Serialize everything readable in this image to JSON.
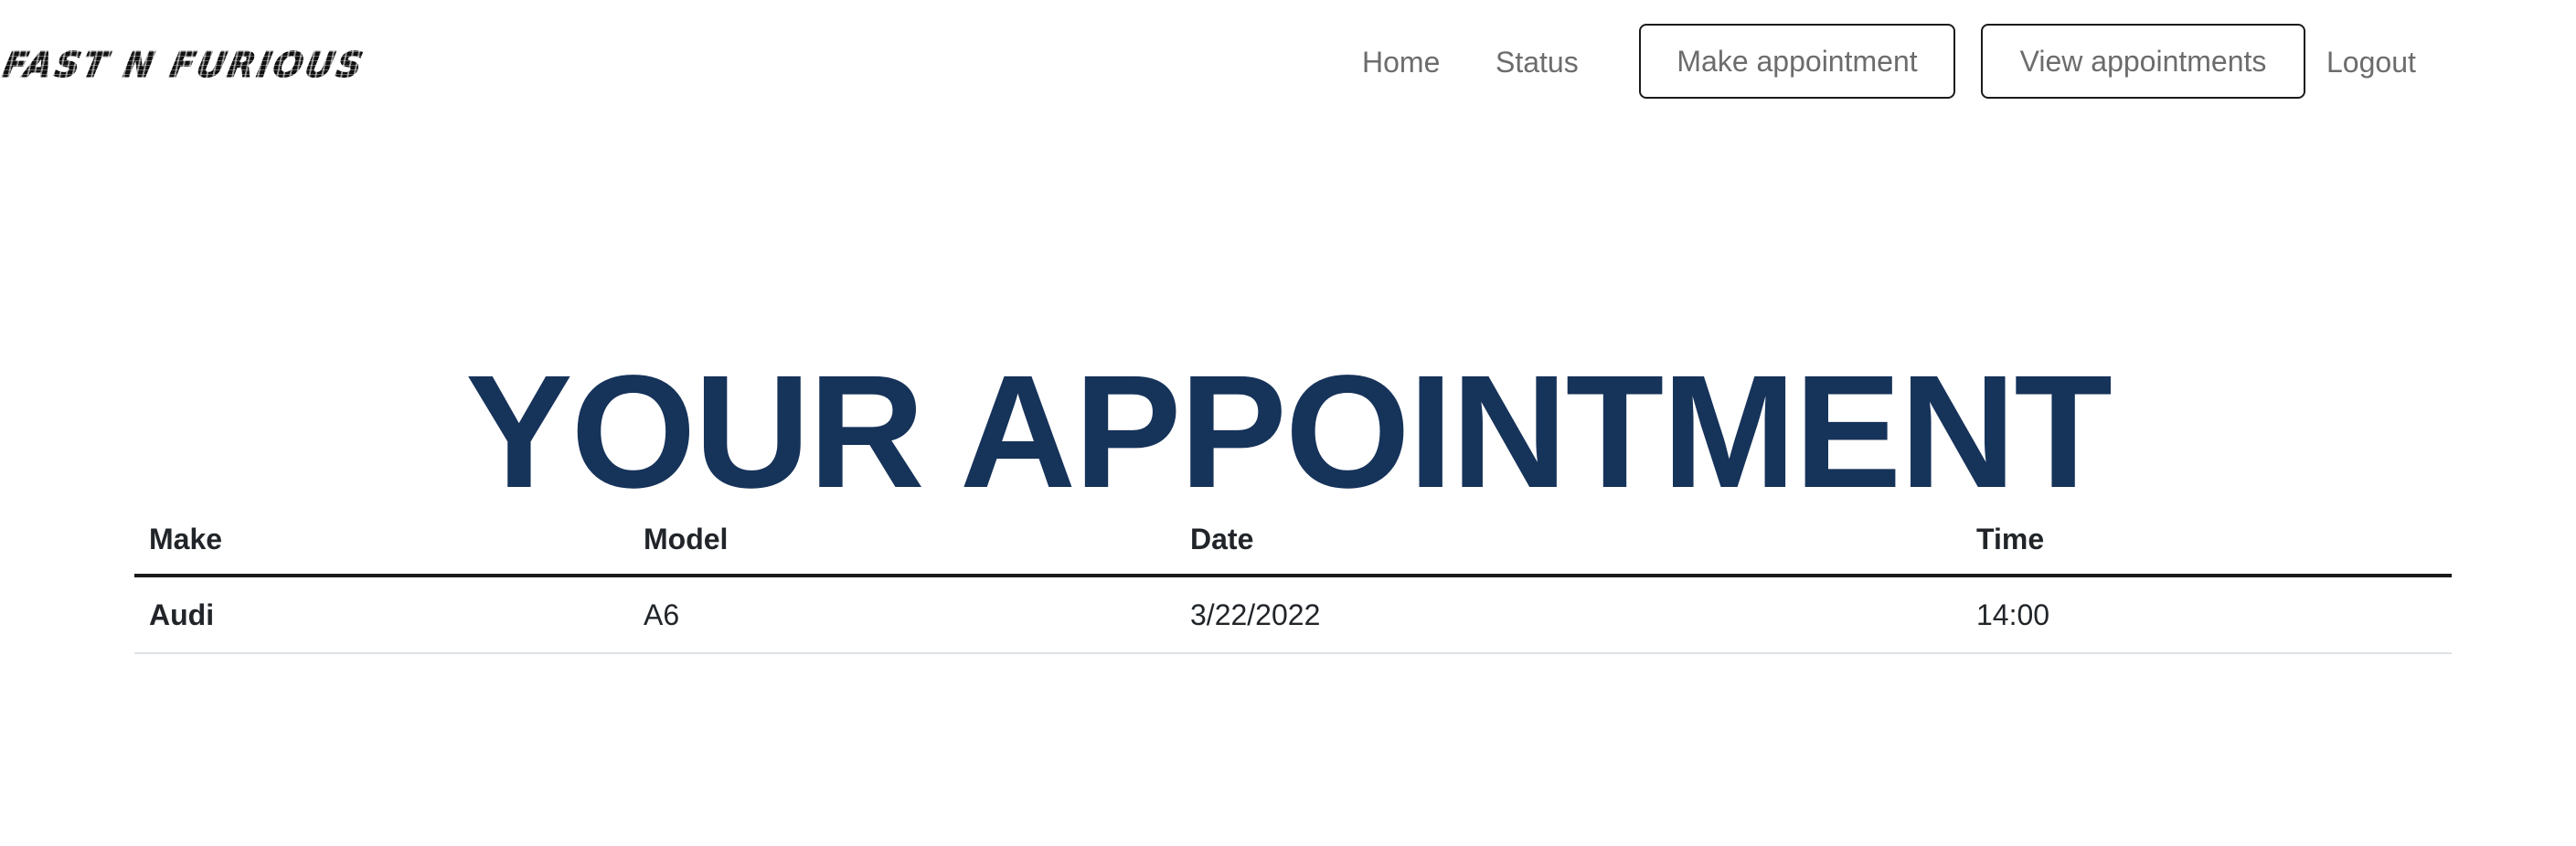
{
  "brand": {
    "logo_text": "FAST N FURIOUS"
  },
  "nav": {
    "home": "Home",
    "status": "Status",
    "make_appointment": "Make appointment",
    "view_appointments": "View appointments",
    "logout": "Logout"
  },
  "page": {
    "title": "YOUR APPOINTMENT"
  },
  "table": {
    "headers": [
      "Make",
      "Model",
      "Date",
      "Time"
    ],
    "rows": [
      [
        "Audi",
        "A6",
        "3/22/2022",
        "14:00"
      ]
    ]
  },
  "colors": {
    "title": "#16335a",
    "nav_text": "#6c6c6c",
    "table_text": "#212529"
  }
}
